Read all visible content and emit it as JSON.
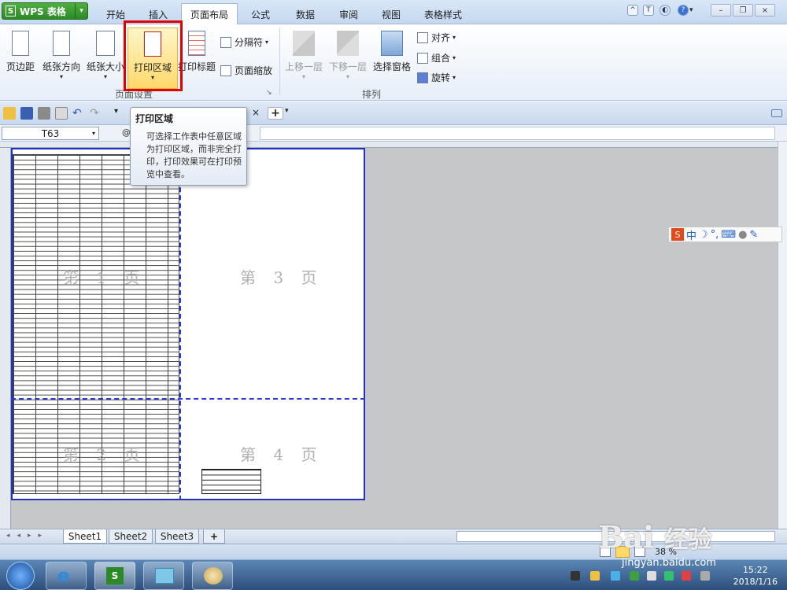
{
  "app": {
    "name": "WPS 表格",
    "logo": "S"
  },
  "tabs": [
    "开始",
    "插入",
    "页面布局",
    "公式",
    "数据",
    "审阅",
    "视图",
    "表格样式"
  ],
  "active_tab": "页面布局",
  "ribbon": {
    "page_setup": {
      "margins": "页边距",
      "orientation": "纸张方向",
      "size": "纸张大小",
      "print_area": "打印区域",
      "print_titles": "打印标题",
      "breaks": "分隔符",
      "scale": "页面缩放",
      "group_label": "页面设置"
    },
    "arrange": {
      "bring_forward": "上移一层",
      "send_backward": "下移一层",
      "selection_pane": "选择窗格",
      "align": "对齐",
      "group": "组合",
      "rotate": "旋转",
      "group_label": "排列"
    }
  },
  "tooltip": {
    "title": "打印区域",
    "body": "可选择工作表中任意区域为打印区域，而非完全打印，打印效果可在打印预览中查看。"
  },
  "name_box": "T63",
  "pages": [
    "第 1 页",
    "第 2 页",
    "第 3 页",
    "第 4 页"
  ],
  "sheets": [
    "Sheet1",
    "Sheet2",
    "Sheet3"
  ],
  "active_sheet": "Sheet1",
  "zoom": "38 %",
  "ime": {
    "mode": "中"
  },
  "clock": {
    "time": "15:22",
    "date": "2018/1/16"
  },
  "watermark": {
    "brand": "Bai",
    "site": "jingyan.baidu.com",
    "product": "经验"
  },
  "colors": {
    "accent_red": "#e00000",
    "page_border": "#1f2fc8",
    "wps_green": "#2b8a26"
  }
}
